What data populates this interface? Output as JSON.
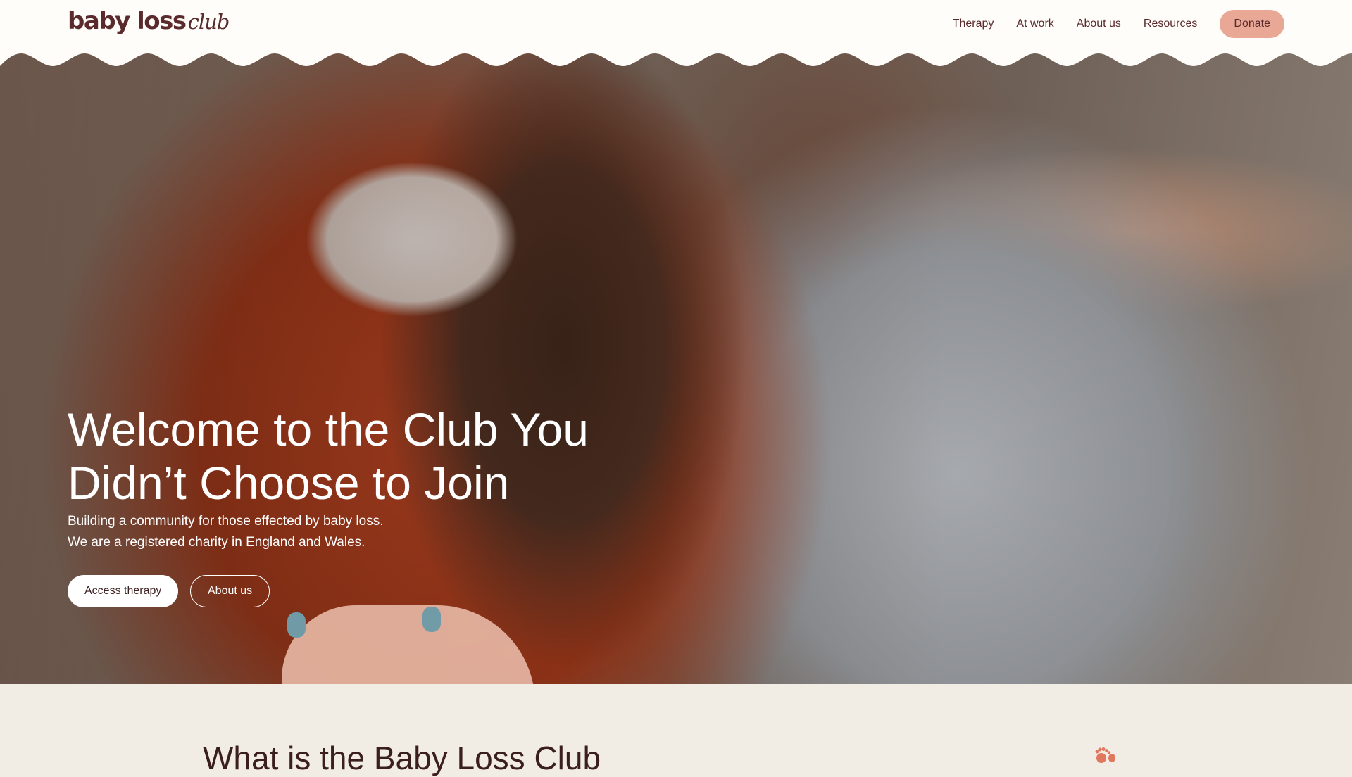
{
  "header": {
    "logo": {
      "bold": "baby loss",
      "script": "club"
    },
    "nav": [
      "Therapy",
      "At work",
      "About us",
      "Resources"
    ],
    "donate_label": "Donate"
  },
  "hero": {
    "title_line1": "Welcome to the Club You",
    "title_line2": "Didn’t Choose to Join",
    "subtitle_line1": "Building a community for those effected by baby loss.",
    "subtitle_line2": "We are a registered charity in England and Wales.",
    "primary_button": "Access therapy",
    "secondary_button": "About us"
  },
  "section": {
    "title": "What is the Baby Loss Club"
  },
  "colors": {
    "brand": "#5a2a2c",
    "donate_bg": "#e9a895",
    "section_bg": "#f2ede4",
    "accent_icon": "#e0775f"
  },
  "icons": {
    "section": "baby-feet-icon"
  }
}
